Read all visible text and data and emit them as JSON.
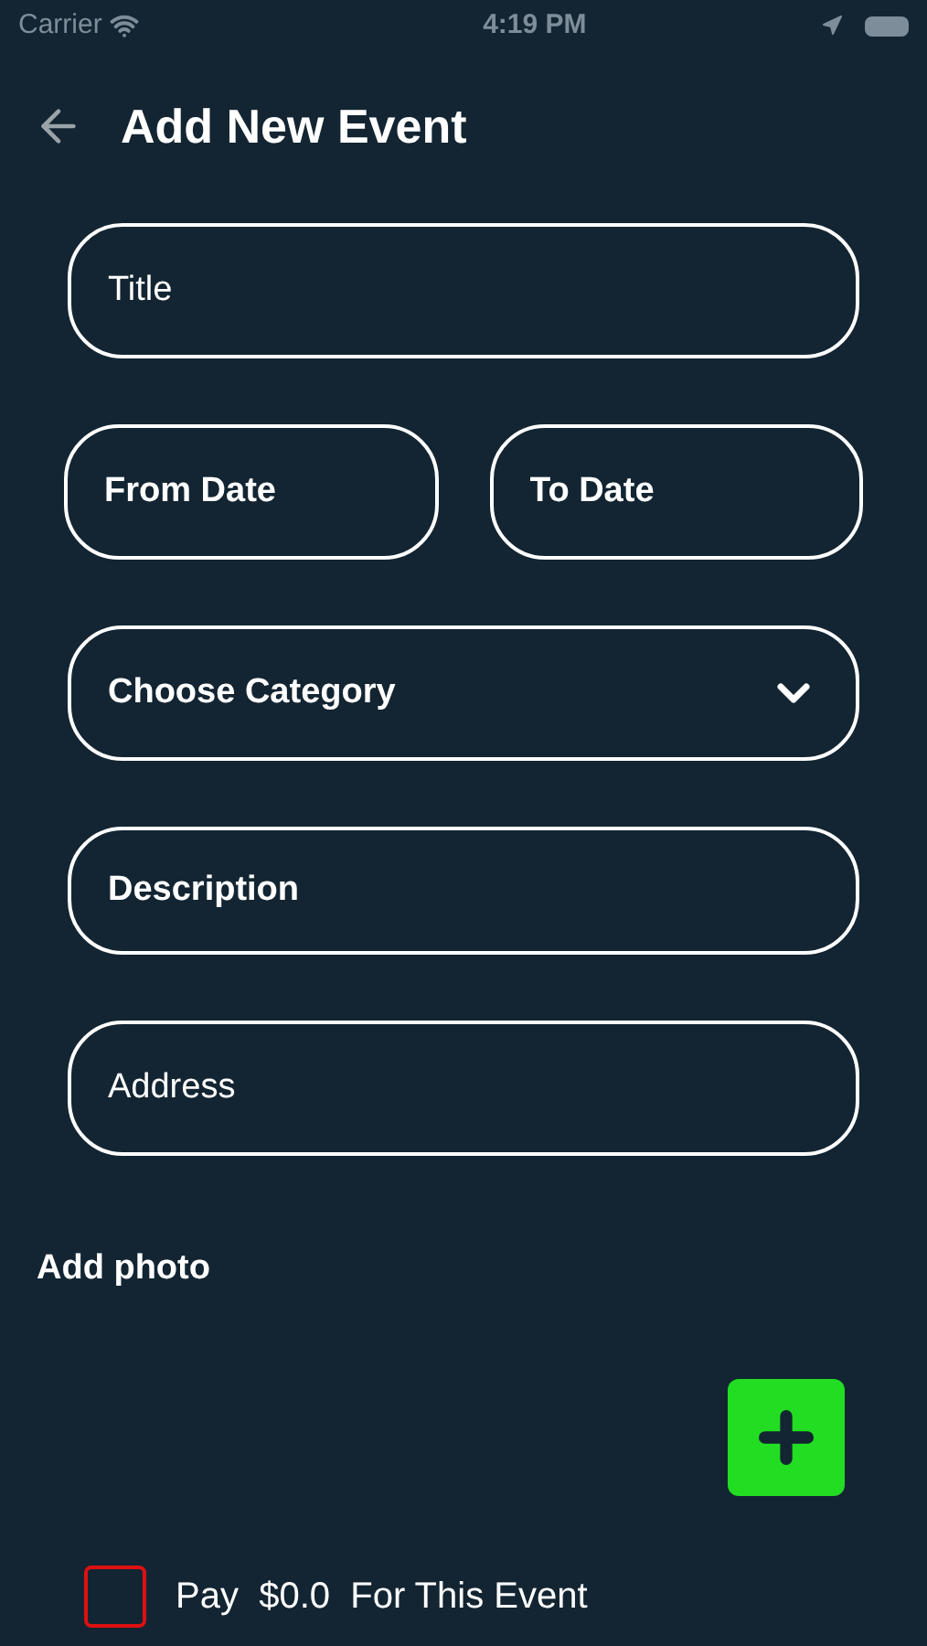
{
  "status_bar": {
    "carrier": "Carrier",
    "time": "4:19 PM"
  },
  "header": {
    "title": "Add New Event"
  },
  "fields": [
    {
      "kind": "text",
      "placeholder": "Title"
    },
    {
      "kind": "date",
      "placeholder": "From Date"
    },
    {
      "kind": "date",
      "placeholder": "To Date"
    },
    {
      "kind": "select",
      "placeholder": "Choose Category"
    },
    {
      "kind": "multiline",
      "placeholder": "Description"
    },
    {
      "kind": "text",
      "placeholder": "Address"
    }
  ],
  "photo": {
    "label": "Add photo"
  },
  "payment": {
    "label": "Pay  $0.0  For This Event",
    "checked": false
  }
}
